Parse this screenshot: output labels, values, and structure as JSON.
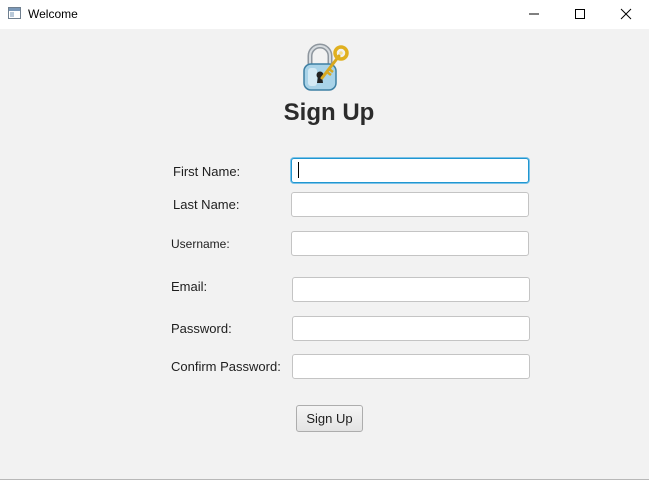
{
  "window": {
    "title": "Welcome"
  },
  "icons": {
    "app": "app-window-icon",
    "lock": "padlock-key-icon",
    "minimize": "minimize-icon",
    "maximize": "maximize-icon",
    "close": "close-icon"
  },
  "form": {
    "heading": "Sign Up",
    "fields": [
      {
        "label": "First Name:",
        "value": ""
      },
      {
        "label": "Last Name:",
        "value": ""
      },
      {
        "label": "Username:",
        "value": ""
      },
      {
        "label": "Email:",
        "value": ""
      },
      {
        "label": "Password:",
        "value": ""
      },
      {
        "label": "Confirm Password:",
        "value": ""
      }
    ],
    "submit_label": "Sign Up"
  },
  "colors": {
    "background": "#f2f2f2",
    "focus_border": "#2096d0",
    "field_border": "#c4c4c4"
  }
}
